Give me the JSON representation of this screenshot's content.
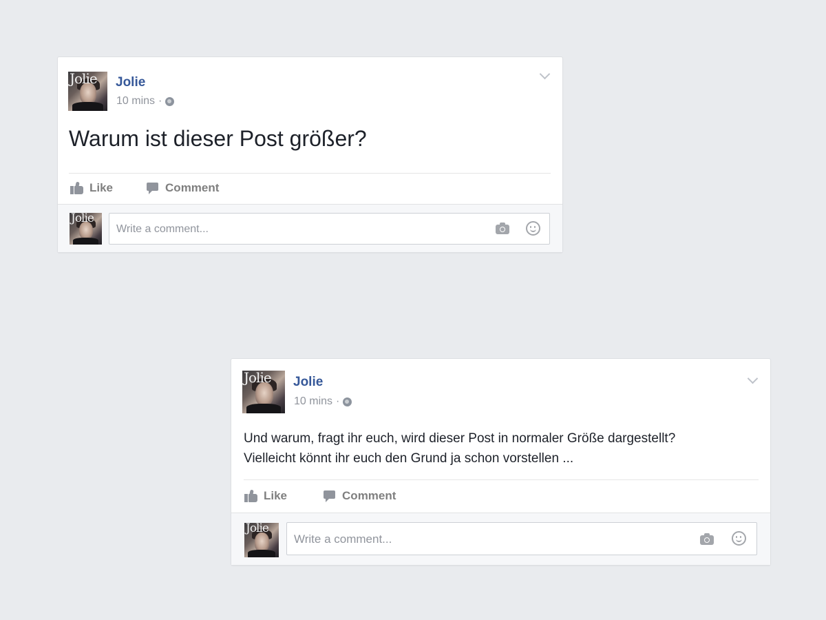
{
  "posts": [
    {
      "author": "Jolie",
      "avatar_text": "Jolie",
      "timestamp": "10 mins",
      "separator": "·",
      "privacy_icon": "globe-icon",
      "text": "Warum ist dieser Post größer?",
      "actions": {
        "like": "Like",
        "comment": "Comment"
      },
      "comment_placeholder": "Write a comment..."
    },
    {
      "author": "Jolie",
      "avatar_text": "Jolie",
      "timestamp": "10 mins",
      "separator": "·",
      "privacy_icon": "globe-icon",
      "text_lines": [
        "Und warum, fragt ihr euch, wird dieser Post in normaler Größe dargestellt?",
        "Vielleicht könnt ihr euch den Grund ja schon vorstellen ..."
      ],
      "actions": {
        "like": "Like",
        "comment": "Comment"
      },
      "comment_placeholder": "Write a comment..."
    }
  ],
  "colors": {
    "background": "#e9ebee",
    "author_link": "#365899",
    "meta_text": "#90949c",
    "action_text": "#7f7f7f"
  }
}
